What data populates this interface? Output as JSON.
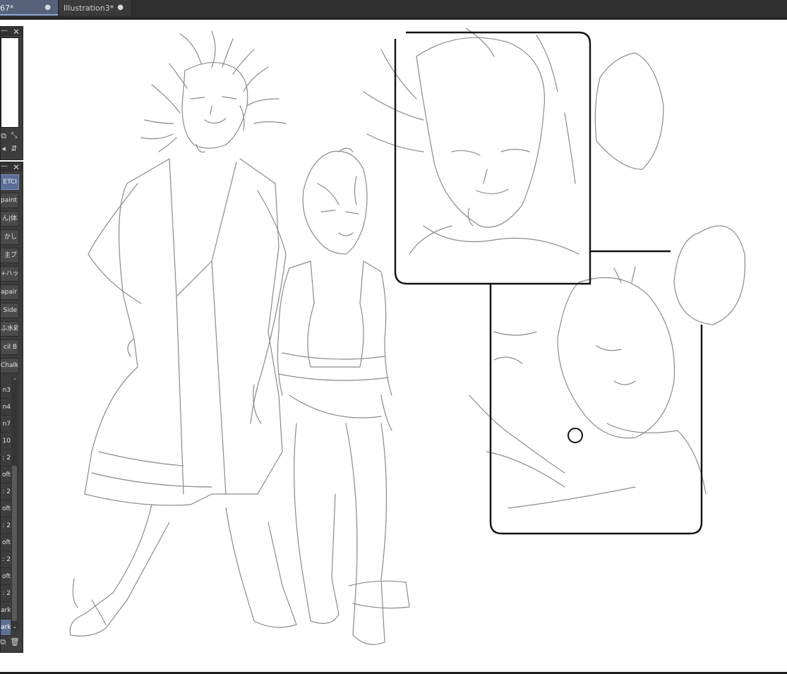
{
  "tabs": [
    {
      "label": "67*",
      "modified_dot": "●",
      "active": true
    },
    {
      "label": "Illustration3*",
      "modified_dot": "●",
      "active": false
    }
  ],
  "navigator_panel": {
    "close_glyph": "✕",
    "title_glyph": "—",
    "icons": [
      "fit-window-icon",
      "actual-size-icon",
      "rotate-left-icon",
      "flip-icon"
    ]
  },
  "brush_panel": {
    "close_glyph": "✕",
    "title_glyph": "—",
    "brushes": [
      {
        "label": "ETCI",
        "selected": true
      },
      {
        "label": "paint",
        "selected": false
      },
      {
        "label": "ん|体",
        "selected": false
      },
      {
        "label": "かし",
        "selected": false
      },
      {
        "label": "主ブ",
        "selected": false
      },
      {
        "label": "+ハッ",
        "selected": false
      },
      {
        "label": "apair",
        "selected": false
      },
      {
        "label": "Side",
        "selected": false
      },
      {
        "label": "ふ水彩",
        "selected": false
      },
      {
        "label": "cil B",
        "selected": false
      },
      {
        "label": "Chalk",
        "selected": false
      }
    ]
  },
  "layers_panel": {
    "layers": [
      {
        "label": "n3",
        "selected": false
      },
      {
        "label": "n4",
        "selected": false
      },
      {
        "label": "n7",
        "selected": false
      },
      {
        "label": "10",
        "selected": false
      },
      {
        "label": ": 2",
        "selected": false
      },
      {
        "label": "oft",
        "selected": false
      },
      {
        "label": ": 2",
        "selected": false
      },
      {
        "label": "oft",
        "selected": false
      },
      {
        "label": ": 2",
        "selected": false
      },
      {
        "label": "oft",
        "selected": false
      },
      {
        "label": ": 2",
        "selected": false
      },
      {
        "label": "oft",
        "selected": false
      },
      {
        "label": ": 2",
        "selected": false
      },
      {
        "label": "ark",
        "selected": false
      },
      {
        "label": "ark",
        "selected": true
      }
    ],
    "scroll_up": "⌃",
    "scroll_down": "⌄"
  },
  "colors": {
    "canvas": "#ffffff",
    "panel": "#3d3d3d",
    "selected_accent": "#5c6f96",
    "sketch_line": "#8a8a8a",
    "panel_border_line": "#111111"
  }
}
